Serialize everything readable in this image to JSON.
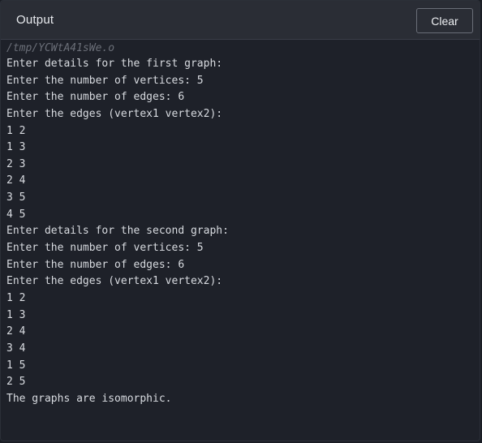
{
  "header": {
    "title": "Output",
    "clear_label": "Clear"
  },
  "console": {
    "file_path": "/tmp/YCWtA41sWe.o",
    "lines": [
      "Enter details for the first graph:",
      "Enter the number of vertices: 5",
      "Enter the number of edges: 6",
      "Enter the edges (vertex1 vertex2):",
      "1 2",
      "1 3",
      "2 3",
      "2 4",
      "3 5",
      "4 5",
      "Enter details for the second graph:",
      "Enter the number of vertices: 5",
      "Enter the number of edges: 6",
      "Enter the edges (vertex1 vertex2):",
      "1 2",
      "1 3",
      "2 4",
      "3 4",
      "1 5",
      "2 5",
      "The graphs are isomorphic."
    ]
  },
  "colors": {
    "background": "#1e2129",
    "header": "#2a2d35",
    "text": "#d8dbe0",
    "path_text": "#6b6f78"
  }
}
